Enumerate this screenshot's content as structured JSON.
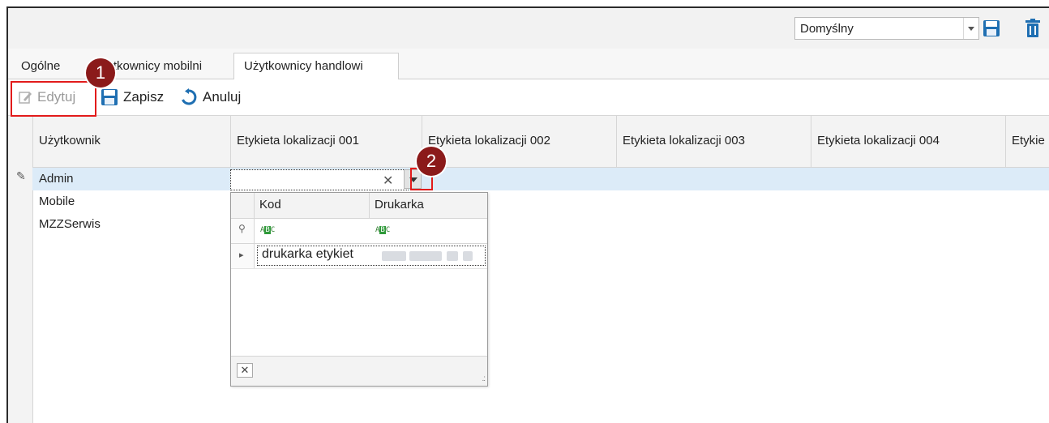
{
  "topbar": {
    "layout_value": "Domyślny",
    "save_icon": "save-icon",
    "delete_icon": "trash-icon"
  },
  "tabs": [
    {
      "label": "Ogólne"
    },
    {
      "label": "Użytkownicy mobilni"
    },
    {
      "label": "Użytkownicy handlowi"
    }
  ],
  "actions": {
    "edit": "Edytuj",
    "save": "Zapisz",
    "cancel": "Anuluj"
  },
  "grid": {
    "columns": [
      "Użytkownik",
      "Etykieta lokalizacji 001",
      "Etykieta lokalizacji 002",
      "Etykieta lokalizacji 003",
      "Etykieta lokalizacji 004",
      "Etykie"
    ],
    "rows": [
      "Admin",
      "Mobile",
      "MZZSerwis"
    ]
  },
  "popup": {
    "columns": [
      "Kod",
      "Drukarka"
    ],
    "filter_glyph": "ABC",
    "row_kod": "drukarka etykiet",
    "close_glyph": "✕",
    "resize_glyph": ".:"
  },
  "badges": {
    "first": "1",
    "second": "2"
  },
  "colors": {
    "accent": "#1f6fb2",
    "highlight_row": "#dcebf8",
    "callout": "#8b1a1a",
    "callout_border": "#e21b1b"
  }
}
